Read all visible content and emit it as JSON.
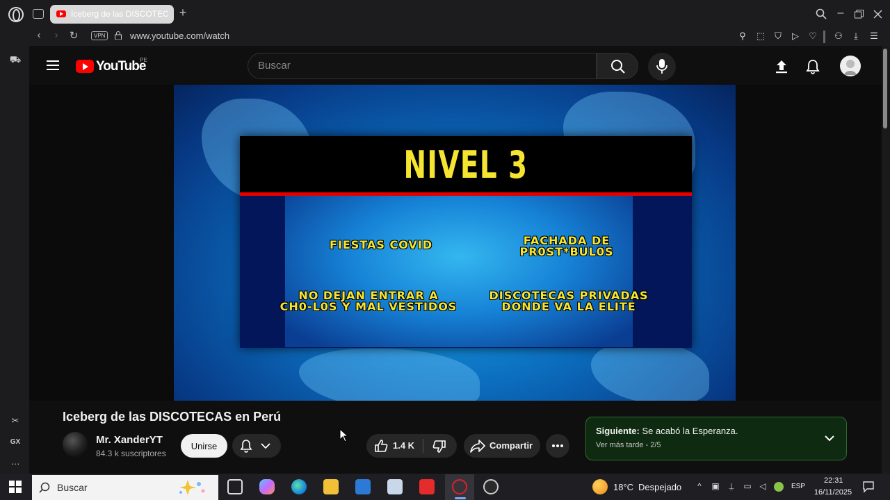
{
  "browser": {
    "tab_title": "Iceberg de las DISCOTECAS",
    "url": "www.youtube.com/watch",
    "vpn_label": "VPN",
    "sidebar_gx_label": "GX"
  },
  "youtube": {
    "wordmark": "YouTube",
    "country_code": "PE",
    "search_placeholder": "Buscar"
  },
  "video_frame": {
    "level_title": "NIVEL 3",
    "tags": [
      "FIESTAS COVID",
      "FACHADA DE\nPR0ST*BUL0S",
      "NO DEJAN ENTRAR A\nCH0-L0S Y MAL VESTIDOS",
      "DISCOTECAS PRIVADAS\nDONDE VA LA ELITE"
    ]
  },
  "video": {
    "title": "Iceberg de las DISCOTECAS en Perú",
    "channel_name": "Mr. XanderYT",
    "subscribers": "84.3 k suscriptores",
    "join_label": "Unirse",
    "like_count": "1.4 K",
    "share_label": "Compartir"
  },
  "next_card": {
    "prefix": "Siguiente:",
    "next_title": "Se acabó la Esperanza.",
    "playlist": "Ver más tarde - 2/5"
  },
  "taskbar": {
    "search_label": "Buscar",
    "weather_temp": "18°C",
    "weather_desc": "Despejado",
    "language": "ESP",
    "time": "22:31",
    "date": "16/11/2025"
  },
  "colors": {
    "youtube_red": "#ff0000",
    "level_yellow": "#f5e531",
    "next_card_bg": "#0e2a10"
  }
}
